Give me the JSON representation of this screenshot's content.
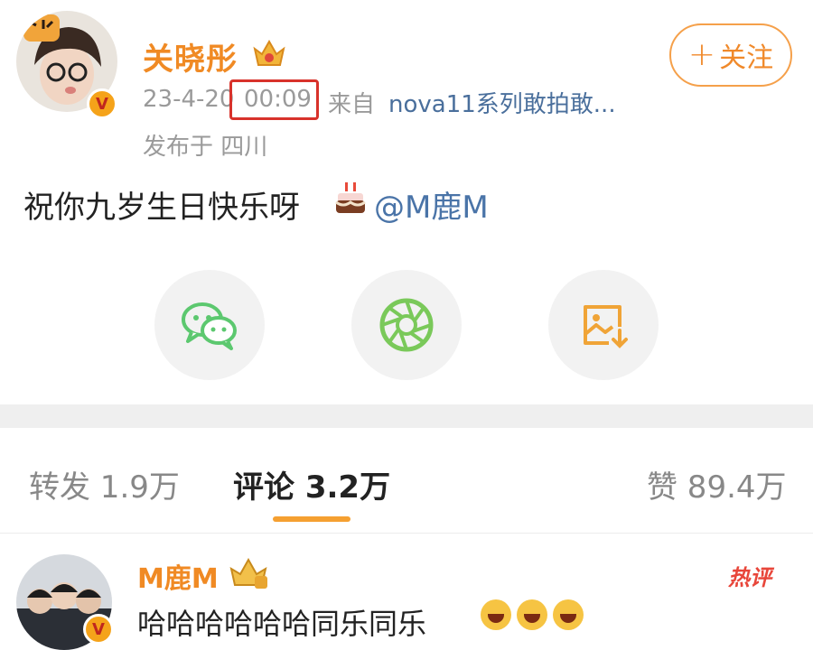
{
  "post": {
    "username": "关晓彤",
    "verified_mark": "V",
    "follow_label": "关注",
    "date": "23-4-20",
    "time": "00:09",
    "from_label": "来自",
    "source": "nova11系列敢拍敢...",
    "location": "发布于 四川",
    "text": "祝你九岁生日快乐呀",
    "mention": "@M鹿M"
  },
  "share": {
    "icons": [
      "wechat-icon",
      "moments-icon",
      "save-image-icon"
    ]
  },
  "tabs": {
    "repost": "转发 1.9万",
    "comments": "评论 3.2万",
    "likes": "赞 89.4万"
  },
  "comment": {
    "username": "M鹿M",
    "verified_mark": "V",
    "badge": "热评",
    "text": "哈哈哈哈哈哈同乐同乐"
  },
  "colors": {
    "accent": "#f08a24",
    "link": "#4a74a8",
    "highlight_box": "#d8322b",
    "wechat_green": "#5cc86f",
    "moments_green": "#7ac95a",
    "save_orange": "#f0a437"
  }
}
